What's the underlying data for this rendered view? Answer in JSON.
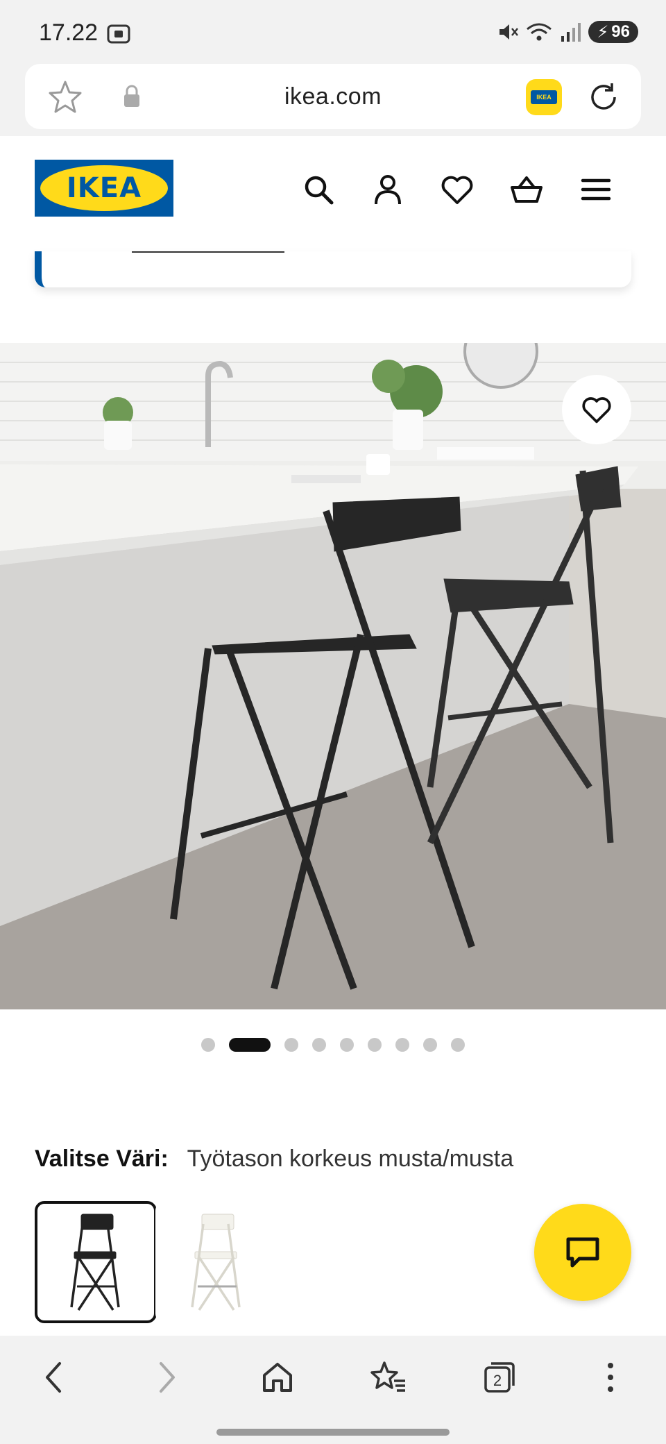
{
  "status_bar": {
    "time": "17.22",
    "battery": "96"
  },
  "browser": {
    "url": "ikea.com",
    "ikea_badge_text": "IKEA"
  },
  "header": {
    "logo_text": "IKEA",
    "icons": [
      "search-icon",
      "account-icon",
      "wishlist-icon",
      "basket-icon",
      "menu-icon"
    ]
  },
  "carousel": {
    "total": 9,
    "active_index": 1
  },
  "color_picker": {
    "label": "Valitse Väri:",
    "selected_value": "Työtason korkeus musta/musta",
    "options": [
      {
        "color": "black",
        "selected": true
      },
      {
        "color": "white",
        "selected": false
      }
    ]
  },
  "colors": {
    "ikea_blue": "#0058a3",
    "ikea_yellow": "#ffda1a"
  },
  "bottom_nav": {
    "tabs_count": "2"
  }
}
